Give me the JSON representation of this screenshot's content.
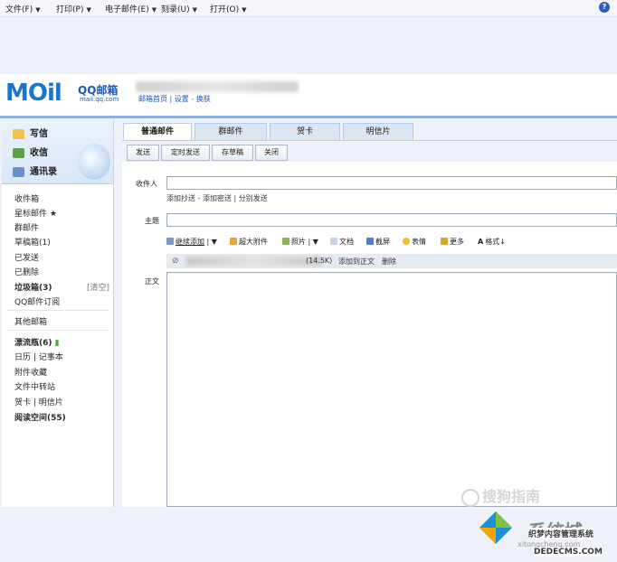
{
  "menubar": {
    "items": [
      "文件(F)",
      "打印(P)",
      "电子邮件(E)",
      "刻录(U)",
      "打开(O)"
    ],
    "help_icon": "?"
  },
  "header": {
    "logo_text": "MOil",
    "logo_product": "QQ邮箱",
    "logo_url": "mail.qq.com",
    "account_links": "邮箱首页 | 设置 - 换肤"
  },
  "sidebar": {
    "quick": [
      {
        "label": "写信",
        "icon": "pencil-icon"
      },
      {
        "label": "收信",
        "icon": "inbox-icon"
      },
      {
        "label": "通讯录",
        "icon": "contacts-icon"
      }
    ],
    "folders": [
      {
        "label": "收件箱"
      },
      {
        "label": "星标邮件 ★"
      },
      {
        "label": "群邮件"
      },
      {
        "label": "草稿箱(1)"
      },
      {
        "label": "已发送"
      },
      {
        "label": "已删除"
      },
      {
        "label": "垃圾箱(3)",
        "action": "[清空]"
      },
      {
        "label": "QQ邮件订阅"
      }
    ],
    "other": "其他邮箱",
    "extras": [
      {
        "label": "漂流瓶(6)"
      },
      {
        "label": "日历 | 记事本"
      },
      {
        "label": "附件收藏"
      },
      {
        "label": "文件中转站"
      },
      {
        "label": "贺卡 | 明信片"
      },
      {
        "label": "阅读空间(55)"
      }
    ]
  },
  "compose": {
    "tabs": [
      "普通邮件",
      "群邮件",
      "贺卡",
      "明信片"
    ],
    "active_tab": 0,
    "buttons": [
      "发送",
      "定时发送",
      "存草稿",
      "关闭"
    ],
    "to_label": "收件人",
    "cc_links": "添加抄送 - 添加密送 | 分别发送",
    "subject_label": "主题",
    "toolbar": [
      {
        "label": "继续添加",
        "icon": "paperclip-icon"
      },
      {
        "label": "超大附件",
        "icon": "big-attachment-icon"
      },
      {
        "label": "照片",
        "icon": "photo-icon"
      },
      {
        "label": "文档",
        "icon": "document-icon"
      },
      {
        "label": "截屏",
        "icon": "screenshot-icon"
      },
      {
        "label": "表情",
        "icon": "emoticon-icon"
      },
      {
        "label": "更多",
        "icon": "more-icon"
      },
      {
        "label": "格式↓",
        "icon": "format-icon"
      }
    ],
    "attachment": {
      "size": "(14.5K)",
      "add_to_body": "添加到正文",
      "delete": "删除"
    },
    "body_label": "正文"
  },
  "watermarks": {
    "sogou": "搜狗指南",
    "site_name": "系统城",
    "site_url": "xitongcheng.com",
    "dede_title": "织梦内容管理系统",
    "dede_url": "DEDECMS.COM"
  },
  "colors": {
    "accent": "#1e74c9",
    "logo_o": "#f2a200",
    "divider": "#8db2de"
  }
}
